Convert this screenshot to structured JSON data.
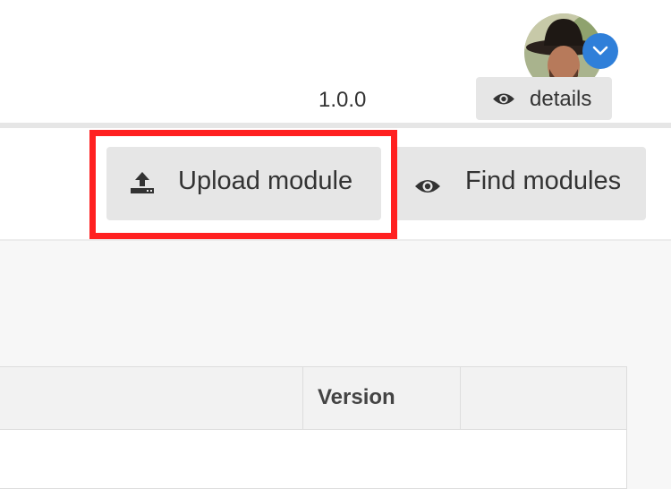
{
  "header": {
    "avatar_icon": "user-avatar",
    "dropdown_icon": "chevron-down-icon",
    "accent_color": "#2f7fd9"
  },
  "toolbar": {
    "upload_label": "Upload module",
    "upload_icon": "upload-icon",
    "find_label": "Find modules",
    "find_icon": "eye-icon",
    "highlight_color": "#ff2020"
  },
  "table": {
    "columns": [
      "",
      "Version",
      ""
    ],
    "rows": [
      {
        "version": "1.0.0",
        "action_label": "details",
        "action_icon": "eye-icon"
      }
    ]
  }
}
